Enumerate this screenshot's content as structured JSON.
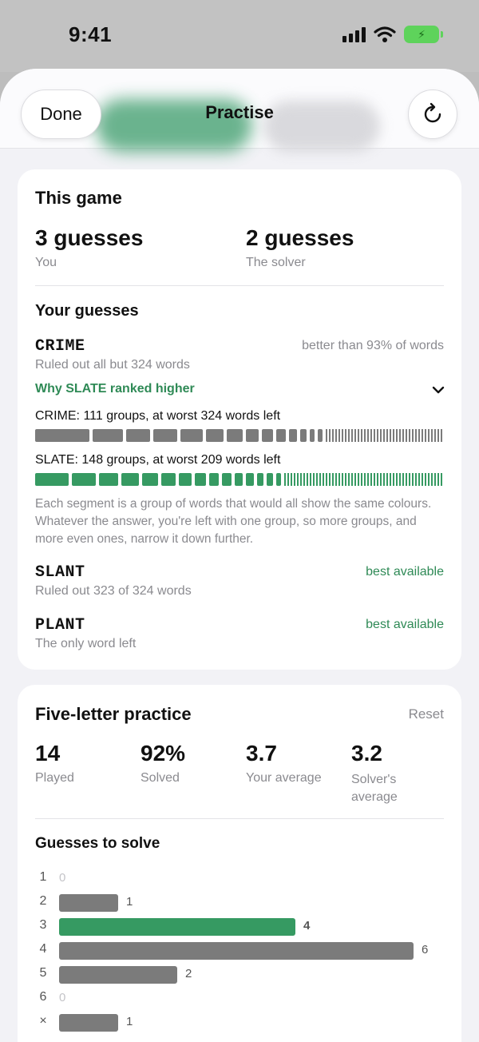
{
  "status_bar": {
    "time": "9:41"
  },
  "header": {
    "done_label": "Done",
    "title": "Practise"
  },
  "this_game": {
    "title": "This game",
    "you": {
      "value": "3 guesses",
      "label": "You"
    },
    "solver": {
      "value": "2 guesses",
      "label": "The solver"
    },
    "guesses_title": "Your guesses",
    "guesses": [
      {
        "word": "CRIME",
        "rating": "better than 93% of words",
        "detail": "Ruled out all but 324 words"
      },
      {
        "word": "SLANT",
        "rating": "best available",
        "detail": "Ruled out 323 of 324 words"
      },
      {
        "word": "PLANT",
        "rating": "best available",
        "detail": "The only word left"
      }
    ],
    "why_link": "Why SLATE ranked higher",
    "compare": [
      {
        "caption": "CRIME: 111 groups, at worst 324 words left",
        "color": "#7b7b7b"
      },
      {
        "caption": "SLATE: 148 groups, at worst 209 words left",
        "color": "#369a62"
      }
    ],
    "explanation": "Each segment is a group of words that would all show the same colours. Whatever the answer, you're left with one group, so more groups, and more even ones, narrow it down further."
  },
  "practice": {
    "title": "Five-letter practice",
    "reset_label": "Reset",
    "stats": [
      {
        "value": "14",
        "label": "Played"
      },
      {
        "value": "92%",
        "label": "Solved"
      },
      {
        "value": "3.7",
        "label": "Your average"
      },
      {
        "value": "3.2",
        "label": "Solver's average"
      }
    ],
    "dist_title": "Guesses to solve"
  },
  "chart_data": {
    "type": "bar",
    "title": "Guesses to solve",
    "categories": [
      "1",
      "2",
      "3",
      "4",
      "5",
      "6",
      "×"
    ],
    "values": [
      0,
      1,
      4,
      6,
      2,
      0,
      1
    ],
    "highlight_category": "3",
    "colors": {
      "bar": "#7b7b7b",
      "highlight": "#369a62",
      "zero_label": "#c4c4c8"
    }
  }
}
